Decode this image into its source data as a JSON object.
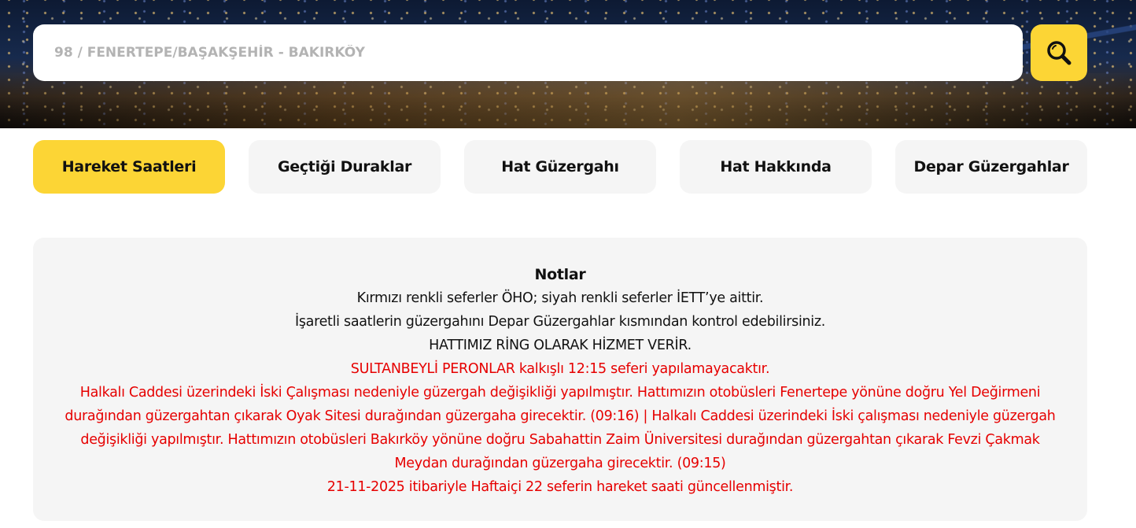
{
  "search": {
    "placeholder": "98 / FENERTEPE/BAŞAKŞEHİR - BAKIRKÖY"
  },
  "tabs": [
    {
      "label": "Hareket Saatleri",
      "active": true
    },
    {
      "label": "Geçtiği Duraklar",
      "active": false
    },
    {
      "label": "Hat Güzergahı",
      "active": false
    },
    {
      "label": "Hat Hakkında",
      "active": false
    },
    {
      "label": "Depar Güzergahlar",
      "active": false
    }
  ],
  "notes": {
    "title": "Notlar",
    "lines": [
      "Kırmızı renkli seferler ÖHO; siyah renkli seferler İETT’ye aittir.",
      "İşaretli saatlerin güzergahını Depar Güzergahlar kısmından kontrol edebilirsiniz.",
      "HATTIMIZ RİNG OLARAK HİZMET VERİR."
    ],
    "red_lines": [
      "SULTANBEYLİ PERONLAR kalkışlı 12:15 seferi yapılamayacaktır.",
      "Halkalı Caddesi üzerindeki İski Çalışması nedeniyle güzergah değişikliği yapılmıştır. Hattımızın otobüsleri Fenertepe yönüne doğru Yel Değirmeni durağından güzergahtan çıkarak Oyak Sitesi durağından güzergaha girecektir. (09:16) | Halkalı Caddesi üzerindeki İski çalışması nedeniyle güzergah değişikliği yapılmıştır. Hattımızın otobüsleri Bakırköy yönüne doğru Sabahattin Zaim Üniversitesi durağından güzergahtan çıkarak Fevzi Çakmak Meydan durağından güzergaha girecektir. (09:15)",
      "21-11-2025 itibariyle Haftaiçi 22 seferin hareket saati güncellenmiştir."
    ]
  },
  "colors": {
    "accent": "#fcd535",
    "tab_bg": "#f5f5f5",
    "warning_text": "#e60000"
  },
  "icons": {
    "search_button": "search-icon"
  }
}
